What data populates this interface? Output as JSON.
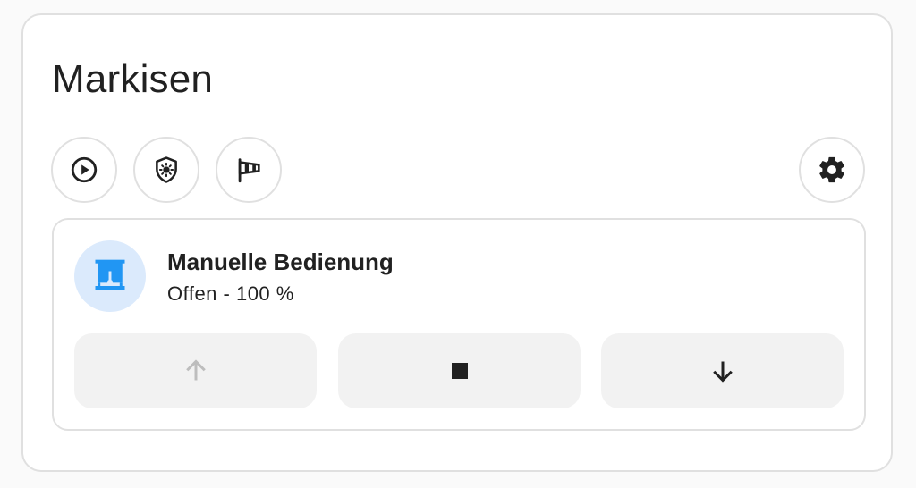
{
  "card": {
    "title": "Markisen"
  },
  "chips": [
    {
      "icon": "play-circle-icon",
      "interactable": true
    },
    {
      "icon": "shield-sun-icon",
      "interactable": true
    },
    {
      "icon": "windsock-icon",
      "interactable": true
    },
    {
      "icon": "gear-icon",
      "interactable": true
    }
  ],
  "entity": {
    "name": "Manuelle Bedienung",
    "state": "Offen - 100 %",
    "position_percent": 100,
    "icon": "awning-icon",
    "icon_color": "#2196f3",
    "icon_bg": "#dbeafc"
  },
  "controls": {
    "open": {
      "icon": "arrow-up-icon",
      "disabled": true
    },
    "stop": {
      "icon": "stop-icon",
      "disabled": false
    },
    "close": {
      "icon": "arrow-down-icon",
      "disabled": false
    }
  }
}
